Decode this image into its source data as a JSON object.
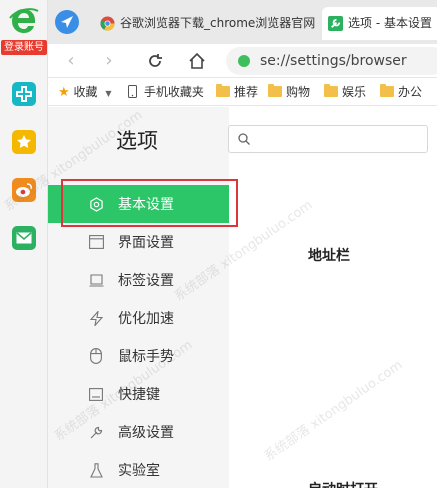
{
  "sidebar_strip": {
    "login_label": "登录账号",
    "icons": [
      "ie-e-icon",
      "plus-cross-icon",
      "star-icon",
      "weibo-icon",
      "mail-icon"
    ]
  },
  "tabs": [
    {
      "title": "谷歌浏览器下载_chrome浏览器官网",
      "icon": "chrome-icon",
      "active": false
    },
    {
      "title": "选项 - 基本设置",
      "icon": "wrench-icon",
      "active": true
    }
  ],
  "address": {
    "url": "se://settings/browser"
  },
  "bookmarks": {
    "favorites_label": "收藏",
    "items": [
      "手机收藏夹",
      "推荐",
      "购物",
      "娱乐",
      "办公"
    ]
  },
  "settings": {
    "title": "选项",
    "search_placeholder": "",
    "menu": [
      {
        "label": "基本设置",
        "icon": "gear-icon",
        "active": true
      },
      {
        "label": "界面设置",
        "icon": "window-icon",
        "active": false
      },
      {
        "label": "标签设置",
        "icon": "tab-icon",
        "active": false
      },
      {
        "label": "优化加速",
        "icon": "lightning-icon",
        "active": false
      },
      {
        "label": "鼠标手势",
        "icon": "mouse-icon",
        "active": false
      },
      {
        "label": "快捷键",
        "icon": "keyboard-icon",
        "active": false
      },
      {
        "label": "高级设置",
        "icon": "wrench-icon",
        "active": false
      },
      {
        "label": "实验室",
        "icon": "flask-icon",
        "active": false
      }
    ],
    "sections": [
      "地址栏",
      "启动时打开"
    ]
  },
  "colors": {
    "accent_green": "#2cc668",
    "highlight_red": "#d9363e",
    "login_red": "#e63b2e"
  },
  "watermark": "系统部落 xitongbuluo.com"
}
